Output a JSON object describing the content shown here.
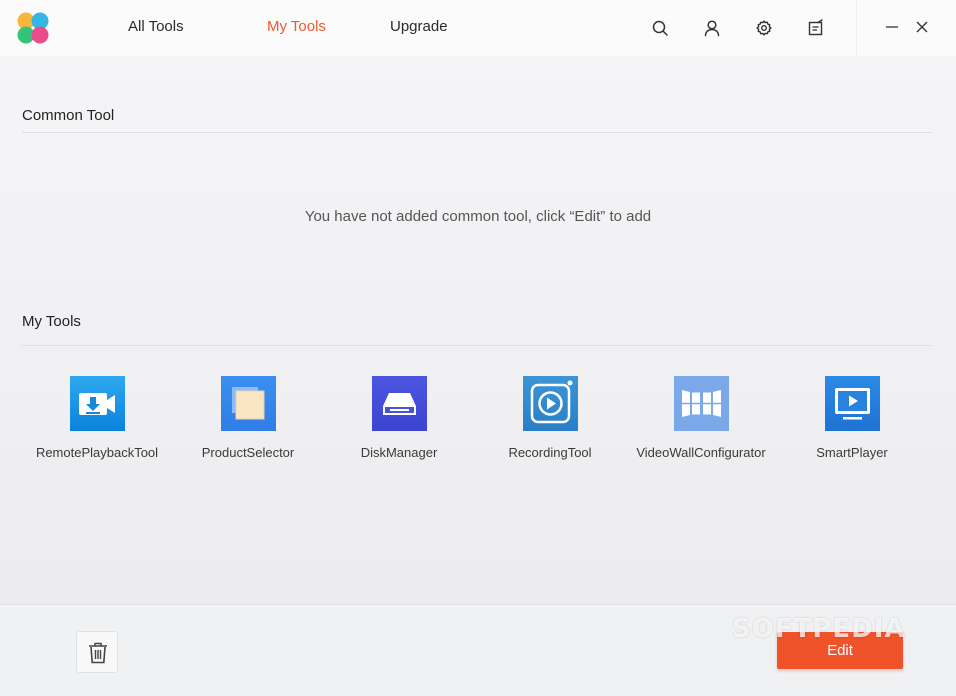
{
  "nav": {
    "tabs": [
      {
        "label": "All Tools",
        "active": false
      },
      {
        "label": "My Tools",
        "active": true
      },
      {
        "label": "Upgrade",
        "active": false
      }
    ]
  },
  "toolbar_icons": [
    "search-icon",
    "user-icon",
    "gear-icon",
    "notes-icon"
  ],
  "window_controls": [
    "minimize-icon",
    "close-icon"
  ],
  "common_tool": {
    "title": "Common Tool",
    "empty_message": "You have not added common tool, click “Edit” to add"
  },
  "my_tools": {
    "title": "My Tools",
    "items": [
      {
        "label": "RemotePlaybackTool",
        "icon": "remote-playback-icon"
      },
      {
        "label": "ProductSelector",
        "icon": "product-selector-icon"
      },
      {
        "label": "DiskManager",
        "icon": "disk-manager-icon"
      },
      {
        "label": "RecordingTool",
        "icon": "recording-tool-icon"
      },
      {
        "label": "VideoWallConfigurator",
        "icon": "video-wall-icon"
      },
      {
        "label": "SmartPlayer",
        "icon": "smart-player-icon"
      }
    ]
  },
  "footer": {
    "edit_label": "Edit",
    "trash_icon": "trash-icon"
  },
  "watermark": "SOFTPEDIA",
  "colors": {
    "accent": "#ee5a2c",
    "edit_button": "#f0522a"
  }
}
